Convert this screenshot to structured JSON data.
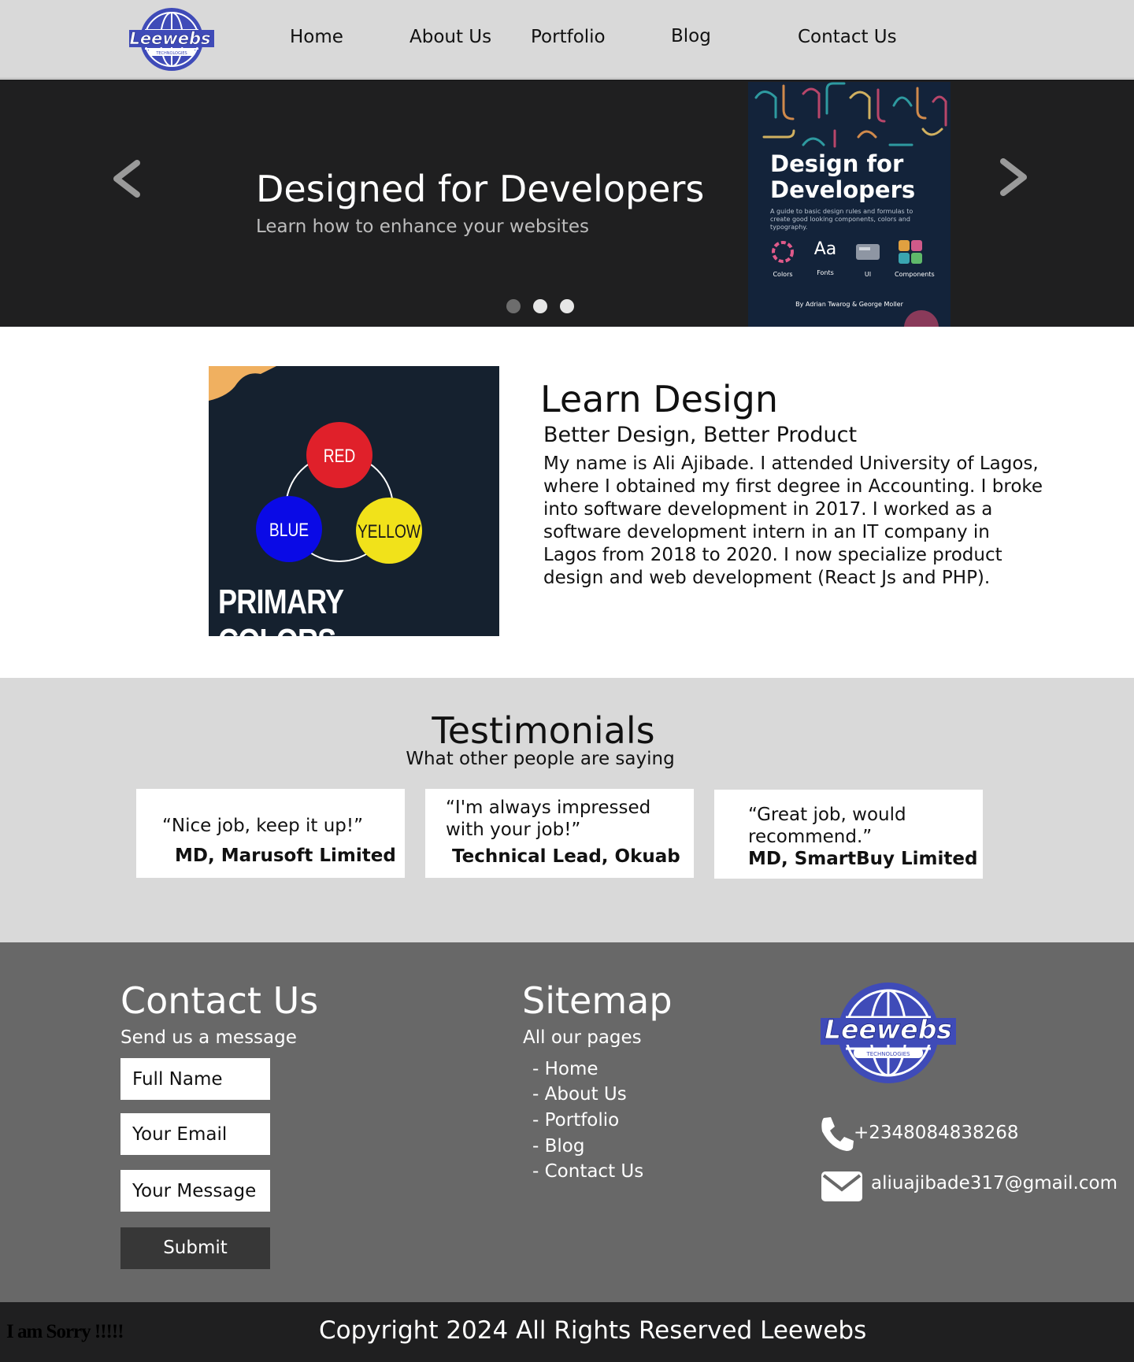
{
  "brand": {
    "logo_text": "Leewebs",
    "logo_sub": "TECHNOLOGIES"
  },
  "nav": {
    "items": [
      "Home",
      "About Us",
      "Portfolio",
      "Blog",
      "Contact Us"
    ]
  },
  "hero": {
    "title": "Designed for Developers",
    "subtitle": "Learn how to enhance your websites",
    "slides": 3,
    "active_slide": 0,
    "book": {
      "title_line1": "Design for",
      "title_line2": "Developers",
      "description": "A guide to basic design rules and formulas to create good looking components, colors and typography.",
      "icon_labels": [
        "Colors",
        "Fonts",
        "UI",
        "Components"
      ],
      "fonts_glyph": "Aa",
      "author": "By Adrian Twarog & George Moller"
    }
  },
  "about": {
    "image": {
      "circles": [
        "RED",
        "BLUE",
        "YELLOW"
      ],
      "caption": "PRIMARY COLORS"
    },
    "heading": "Learn Design",
    "subheading": "Better Design, Better Product",
    "paragraph": "My name is Ali Ajibade. I attended University of Lagos, where I obtained my first degree in Accounting. I broke into software development in 2017. I worked as a software development intern in an IT company in Lagos from 2018 to 2020. I now specialize product design and web development (React Js and PHP)."
  },
  "testimonials": {
    "heading": "Testimonials",
    "subheading": "What other people are saying",
    "cards": [
      {
        "quote": "“Nice job, keep it up!”",
        "author": "MD, Marusoft Limited"
      },
      {
        "quote": "“I'm always impressed with your job!”",
        "author": "Technical Lead, Okuab"
      },
      {
        "quote": "“Great job, would recommend.”",
        "author": "MD, SmartBuy Limited"
      }
    ]
  },
  "footer": {
    "contact": {
      "heading": "Contact Us",
      "subheading": "Send us a message",
      "name_placeholder": "Full Name",
      "email_placeholder": "Your Email",
      "message_placeholder": "Your Message",
      "submit_label": "Submit"
    },
    "sitemap": {
      "heading": "Sitemap",
      "subheading": "All our pages",
      "links": [
        "- Home",
        "- About Us",
        "- Portfolio",
        "- Blog",
        "- Contact Us"
      ]
    },
    "phone": "+2348084838268",
    "email": "aliuajibade317@gmail.com"
  },
  "bottom": {
    "sorry_text": "I am Sorry !!!!!",
    "copyright": "Copyright 2024 All Rights Reserved Leewebs"
  },
  "colors": {
    "nav_bg": "#d9d9d9",
    "hero_bg": "#1f1f20",
    "footer_bg": "#686868",
    "logo_blue": "#3f4bb8"
  }
}
